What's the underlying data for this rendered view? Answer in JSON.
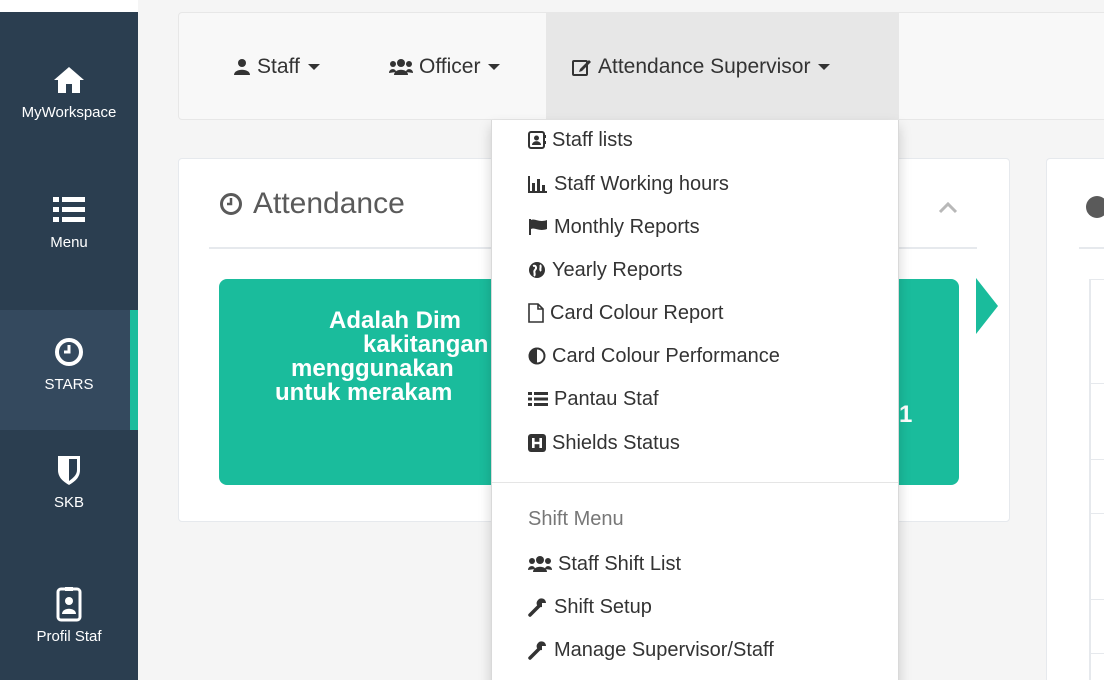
{
  "sidebar": {
    "items": [
      {
        "label": "MyWorkspace",
        "icon": "home-icon"
      },
      {
        "label": "Menu",
        "icon": "list-icon"
      },
      {
        "label": "STARS",
        "icon": "clock-icon",
        "active": true
      },
      {
        "label": "SKB",
        "icon": "shield-icon"
      },
      {
        "label": "Profil Staf",
        "icon": "id-badge-icon"
      }
    ]
  },
  "navbar": {
    "items": [
      {
        "label": "Staff",
        "icon": "user-icon"
      },
      {
        "label": "Officer",
        "icon": "users-icon"
      },
      {
        "label": "Attendance Supervisor",
        "icon": "edit-icon",
        "open": true
      }
    ]
  },
  "dropdown": {
    "items": [
      {
        "label": "Staff lists",
        "icon": "address-card-icon"
      },
      {
        "label": "Staff Working hours",
        "icon": "bar-chart-icon"
      },
      {
        "label": "Monthly Reports",
        "icon": "flag-icon"
      },
      {
        "label": "Yearly Reports",
        "icon": "globe-icon"
      },
      {
        "label": "Card Colour Report",
        "icon": "file-icon"
      },
      {
        "label": "Card Colour Performance",
        "icon": "adjust-icon"
      },
      {
        "label": "Pantau Staf",
        "icon": "list-icon"
      },
      {
        "label": "Shields Status",
        "icon": "h-square-icon"
      }
    ],
    "shift_header": "Shift Menu",
    "shift_items": [
      {
        "label": "Staff Shift List",
        "icon": "users-icon"
      },
      {
        "label": "Shift Setup",
        "icon": "wrench-icon"
      },
      {
        "label": "Manage Supervisor/Staff",
        "icon": "wrench-icon"
      }
    ]
  },
  "attendance_panel": {
    "title": "Attendance",
    "banner_lines": [
      "Adalah Dim",
      "kakitangan",
      "menggunakan",
      "untuk merakam"
    ],
    "banner_tail": "1"
  },
  "colors": {
    "sidebar_bg": "#2b3e50",
    "accent": "#1abc9c",
    "navbar_bg": "#f8f8f8"
  }
}
